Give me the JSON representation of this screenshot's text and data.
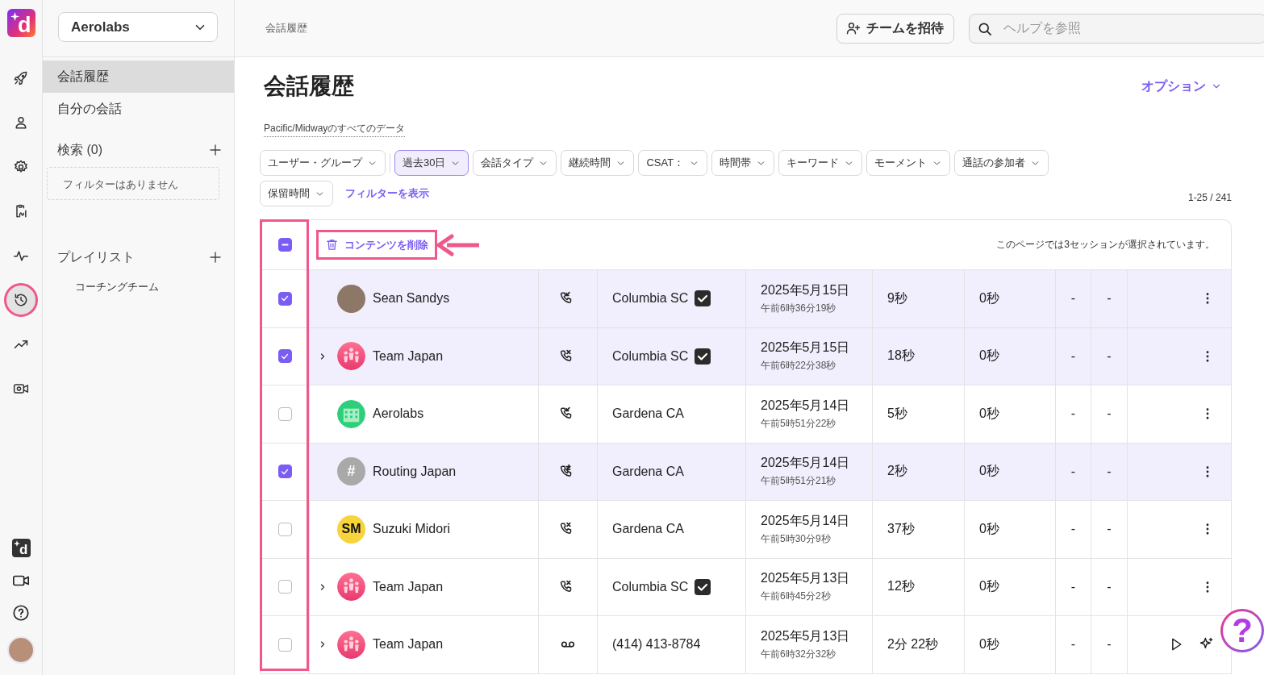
{
  "rail": {
    "logo_letter": "d",
    "items": [
      {
        "kind": "rocket",
        "selected": false,
        "highlighted": false
      },
      {
        "kind": "person",
        "selected": false,
        "highlighted": false
      },
      {
        "kind": "gear",
        "selected": false,
        "highlighted": false
      },
      {
        "kind": "clipboard",
        "selected": false,
        "highlighted": false
      },
      {
        "kind": "pulse",
        "selected": false,
        "highlighted": false
      },
      {
        "kind": "history",
        "selected": true,
        "highlighted": true
      },
      {
        "kind": "trend",
        "selected": false,
        "highlighted": false
      },
      {
        "kind": "camera-gear",
        "selected": false,
        "highlighted": false
      }
    ],
    "bottom_items": [
      {
        "kind": "assistant",
        "letter": "d"
      },
      {
        "kind": "video"
      },
      {
        "kind": "help"
      },
      {
        "kind": "avatar"
      }
    ]
  },
  "workspace_select": {
    "value": "Aerolabs"
  },
  "sidebar": {
    "items": [
      {
        "label": "会話履歴",
        "selected": true
      },
      {
        "label": "自分の会話",
        "selected": false
      }
    ],
    "searches": {
      "title": "検索 (0)",
      "empty_text": "フィルターはありません"
    },
    "playlists": {
      "title": "プレイリスト",
      "items": [
        "コーチングチーム"
      ]
    }
  },
  "header": {
    "breadcrumb": "会話履歴",
    "invite_button": "チームを招待",
    "help_search": {
      "placeholder": "ヘルプを参照"
    }
  },
  "page": {
    "title": "会話履歴",
    "options_link": "オプション",
    "timezone_note": "Pacific/Midwayのすべてのデータ",
    "filters": [
      {
        "label": "ユーザー・グループ",
        "active": false
      },
      {
        "label": "過去30日",
        "active": true
      },
      {
        "label": "会話タイプ",
        "active": false
      },
      {
        "label": "継続時間",
        "active": false
      },
      {
        "label": "CSAT：",
        "active": false
      },
      {
        "label": "時間帯",
        "active": false
      },
      {
        "label": "キーワード",
        "active": false
      },
      {
        "label": "モーメント",
        "active": false
      },
      {
        "label": "通話の参加者",
        "active": false
      },
      {
        "label": "保留時間",
        "active": false
      }
    ],
    "show_filters_link": "フィルターを表示",
    "pagination": "1-25 / 241"
  },
  "table": {
    "checkbox_column_highlighted": true,
    "bulk_bar": {
      "select_all": {
        "indeterminate": true
      },
      "delete_button": {
        "label": "コンテンツを削除",
        "highlighted": true,
        "pointer_arrow": true
      },
      "selection_note": "このページでは3セッションが選択されています。"
    },
    "rows": [
      {
        "selected": true,
        "expandable": false,
        "avatar": {
          "kind": "photo"
        },
        "name": "Sean Sandys",
        "call": {
          "kind": "incoming"
        },
        "location": "Columbia SC",
        "verified": true,
        "date": "2025年5月15日",
        "time": "午前6時36分19秒",
        "duration": "9秒",
        "hold": "0秒",
        "column_8": "-",
        "column_9": "-",
        "actions": [
          {
            "kind": "more"
          }
        ]
      },
      {
        "selected": true,
        "expandable": true,
        "avatar": {
          "kind": "team"
        },
        "name": "Team Japan",
        "call": {
          "kind": "missed"
        },
        "location": "Columbia SC",
        "verified": true,
        "date": "2025年5月15日",
        "time": "午前6時22分38秒",
        "duration": "18秒",
        "hold": "0秒",
        "column_8": "-",
        "column_9": "-",
        "actions": [
          {
            "kind": "more"
          }
        ]
      },
      {
        "selected": false,
        "expandable": false,
        "avatar": {
          "kind": "building"
        },
        "name": "Aerolabs",
        "call": {
          "kind": "incoming"
        },
        "location": "Gardena CA",
        "verified": false,
        "date": "2025年5月14日",
        "time": "午前5時51分22秒",
        "duration": "5秒",
        "hold": "0秒",
        "column_8": "-",
        "column_9": "-",
        "actions": [
          {
            "kind": "more"
          }
        ]
      },
      {
        "selected": true,
        "expandable": false,
        "avatar": {
          "kind": "initials",
          "text": "#",
          "color": "#a9a9a9"
        },
        "name": "Routing Japan",
        "call": {
          "kind": "transfer"
        },
        "location": "Gardena CA",
        "verified": false,
        "date": "2025年5月14日",
        "time": "午前5時51分21秒",
        "duration": "2秒",
        "hold": "0秒",
        "column_8": "-",
        "column_9": "-",
        "actions": [
          {
            "kind": "more"
          }
        ]
      },
      {
        "selected": false,
        "expandable": false,
        "avatar": {
          "kind": "initials",
          "text": "SM",
          "color": "#f8d43c"
        },
        "name": "Suzuki Midori",
        "call": {
          "kind": "missed"
        },
        "location": "Gardena CA",
        "verified": false,
        "date": "2025年5月14日",
        "time": "午前5時30分9秒",
        "duration": "37秒",
        "hold": "0秒",
        "column_8": "-",
        "column_9": "-",
        "actions": [
          {
            "kind": "more"
          }
        ]
      },
      {
        "selected": false,
        "expandable": true,
        "avatar": {
          "kind": "team"
        },
        "name": "Team Japan",
        "call": {
          "kind": "missed"
        },
        "location": "Columbia SC",
        "verified": true,
        "date": "2025年5月13日",
        "time": "午前6時45分2秒",
        "duration": "12秒",
        "hold": "0秒",
        "column_8": "-",
        "column_9": "-",
        "actions": [
          {
            "kind": "more"
          }
        ]
      },
      {
        "selected": false,
        "expandable": true,
        "avatar": {
          "kind": "team"
        },
        "name": "Team Japan",
        "call": {
          "kind": "voicemail"
        },
        "location": "(414) 413-8784",
        "verified": false,
        "date": "2025年5月13日",
        "time": "午前6時32分32秒",
        "duration": "2分 22秒",
        "hold": "0秒",
        "column_8": "-",
        "column_9": "-",
        "actions": [
          {
            "kind": "play"
          },
          {
            "kind": "ai"
          }
        ]
      }
    ]
  },
  "help_button": {
    "label": "?"
  }
}
